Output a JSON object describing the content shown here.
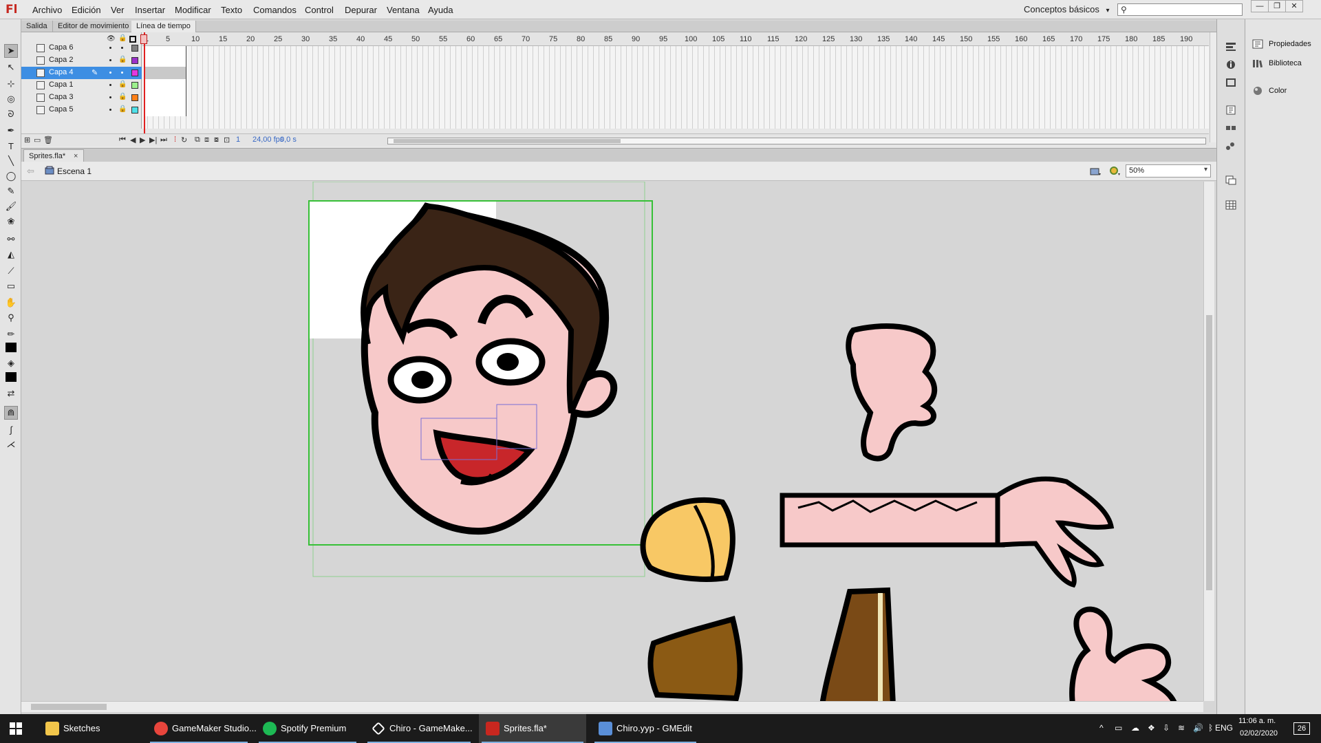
{
  "app": {
    "logo": "Fl"
  },
  "menu": [
    "Archivo",
    "Edición",
    "Ver",
    "Insertar",
    "Modificar",
    "Texto",
    "Comandos",
    "Control",
    "Depurar",
    "Ventana",
    "Ayuda"
  ],
  "workspace": {
    "label": "Conceptos básicos",
    "chevron": "▾"
  },
  "search": {
    "placeholder": "",
    "icon": "magnifier-icon"
  },
  "window_controls": {
    "minimize": "—",
    "restore": "❐",
    "close": "✕"
  },
  "panel_tabs": [
    "Salida",
    "Editor de movimiento",
    "Línea de tiempo"
  ],
  "timeline": {
    "layers": [
      {
        "name": "Capa 6",
        "color": "#7f7f7f",
        "selected": false
      },
      {
        "name": "Capa 2",
        "color": "#9b31c9",
        "selected": false
      },
      {
        "name": "Capa 4",
        "color": "#e238e0",
        "selected": true
      },
      {
        "name": "Capa 1",
        "color": "#9cf08c",
        "selected": false
      },
      {
        "name": "Capa 3",
        "color": "#ff7f16",
        "selected": false
      },
      {
        "name": "Capa 5",
        "color": "#4fe0e8",
        "selected": false
      }
    ],
    "ruler_ticks": [
      "1",
      "5",
      "10",
      "15",
      "20",
      "25",
      "30",
      "35",
      "40",
      "45",
      "50",
      "55",
      "60",
      "65",
      "70",
      "75",
      "80",
      "85",
      "90",
      "95",
      "100",
      "105",
      "110",
      "115",
      "120",
      "125",
      "130",
      "135",
      "140",
      "145",
      "150",
      "155",
      "160",
      "165",
      "170",
      "175",
      "180",
      "185",
      "190"
    ],
    "current_frame": "1",
    "fps": "24,00 fps",
    "time": "0,0 s"
  },
  "document": {
    "tab": "Sprites.fla*",
    "close": "×",
    "scene": "Escena 1",
    "zoom": "50%"
  },
  "right_panel": [
    "Propiedades",
    "Biblioteca",
    "Color"
  ],
  "taskbar": {
    "items": [
      {
        "label": "Sketches",
        "color": "#f2c64b",
        "active": false
      },
      {
        "label": "GameMaker Studio...",
        "color": "#e8453c",
        "active": false
      },
      {
        "label": "Spotify Premium",
        "color": "#1db954",
        "active": false
      },
      {
        "label": "Chiro - GameMake...",
        "color": "#ffffff",
        "active": false
      },
      {
        "label": "Sprites.fla*",
        "color": "#c8271f",
        "active": true
      },
      {
        "label": "Chiro.yyp - GMEdit",
        "color": "#5a8fd8",
        "active": false
      }
    ],
    "language": "ENG",
    "time": "11:06 a. m.",
    "date": "02/02/2020",
    "notifications": "26",
    "tray_chevron": "^"
  }
}
